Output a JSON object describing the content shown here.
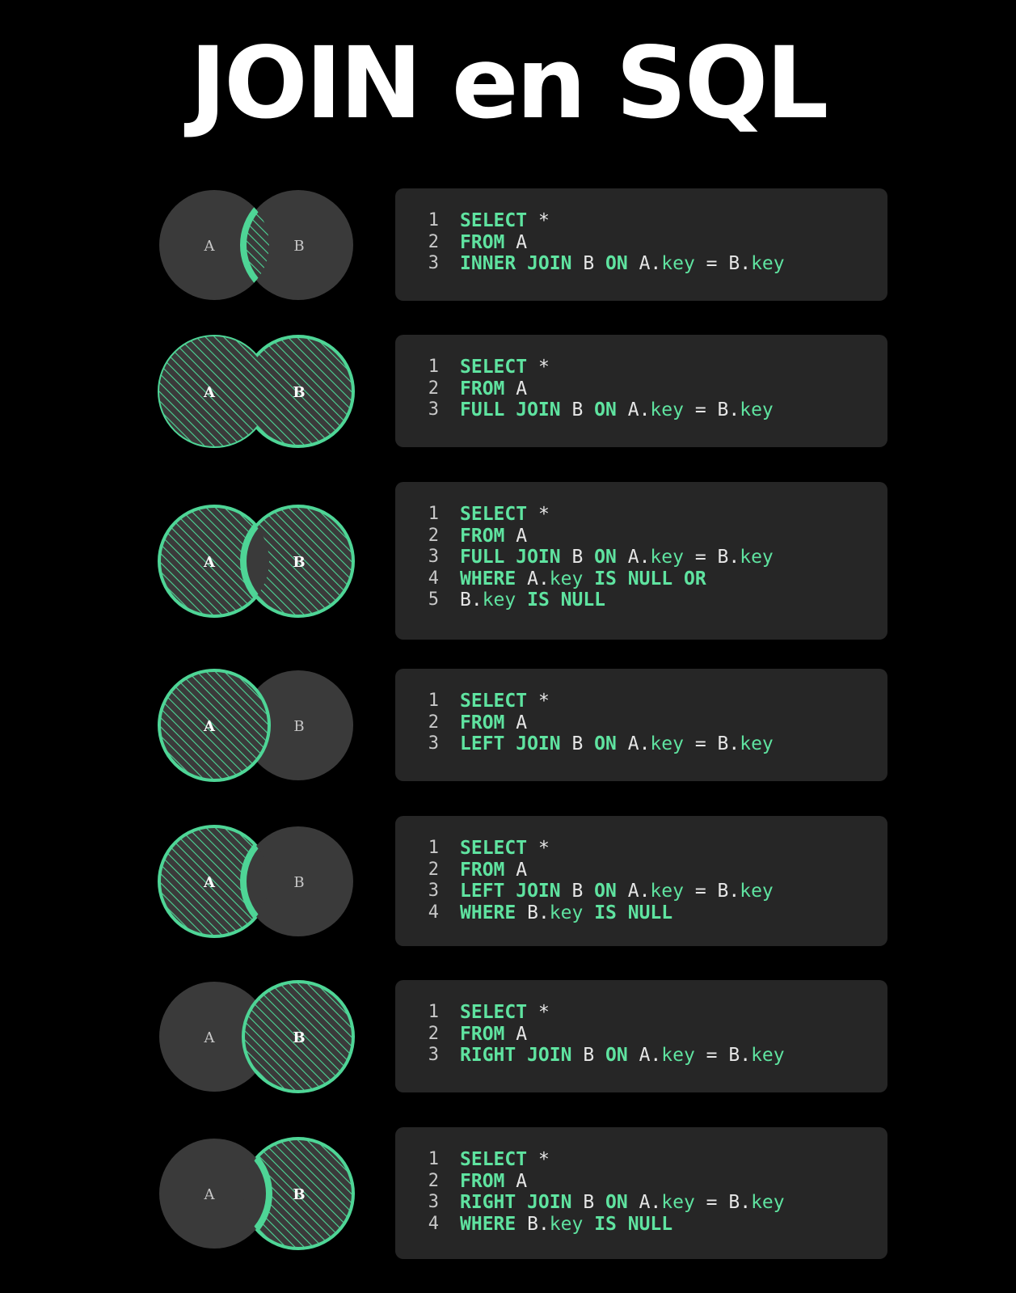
{
  "title": "JOIN en SQL",
  "colors": {
    "background": "#000000",
    "panel": "#262626",
    "circle_fill": "#3a3a3a",
    "accent_green": "#4ed596",
    "keyword": "#5fe3a0",
    "text": "#e6e6e6"
  },
  "joins": [
    {
      "name": "inner-join",
      "venn": {
        "left": "A",
        "right": "B",
        "highlight": "intersection"
      },
      "lines": [
        [
          [
            "kw",
            "SELECT"
          ],
          [
            "op",
            " *"
          ]
        ],
        [
          [
            "kw",
            "FROM"
          ],
          [
            "id",
            " A"
          ]
        ],
        [
          [
            "kw",
            "INNER JOIN"
          ],
          [
            "id",
            " B "
          ],
          [
            "kw",
            "ON"
          ],
          [
            "id",
            " A."
          ],
          [
            "key",
            "key"
          ],
          [
            "op",
            " = "
          ],
          [
            "id",
            "B."
          ],
          [
            "key",
            "key"
          ]
        ]
      ]
    },
    {
      "name": "full-join",
      "venn": {
        "left": "A",
        "right": "B",
        "highlight": "all"
      },
      "lines": [
        [
          [
            "kw",
            "SELECT"
          ],
          [
            "op",
            " *"
          ]
        ],
        [
          [
            "kw",
            "FROM"
          ],
          [
            "id",
            " A"
          ]
        ],
        [
          [
            "kw",
            "FULL JOIN"
          ],
          [
            "id",
            " B "
          ],
          [
            "kw",
            "ON"
          ],
          [
            "id",
            " A."
          ],
          [
            "key",
            "key"
          ],
          [
            "op",
            " = "
          ],
          [
            "id",
            "B."
          ],
          [
            "key",
            "key"
          ]
        ]
      ]
    },
    {
      "name": "full-join-exclusive",
      "venn": {
        "left": "A",
        "right": "B",
        "highlight": "exclusive-both"
      },
      "lines": [
        [
          [
            "kw",
            "SELECT"
          ],
          [
            "op",
            " *"
          ]
        ],
        [
          [
            "kw",
            "FROM"
          ],
          [
            "id",
            " A"
          ]
        ],
        [
          [
            "kw",
            "FULL JOIN"
          ],
          [
            "id",
            " B "
          ],
          [
            "kw",
            "ON"
          ],
          [
            "id",
            " A."
          ],
          [
            "key",
            "key"
          ],
          [
            "op",
            " = "
          ],
          [
            "id",
            "B."
          ],
          [
            "key",
            "key"
          ]
        ],
        [
          [
            "kw",
            "WHERE"
          ],
          [
            "id",
            " A."
          ],
          [
            "key",
            "key"
          ],
          [
            "kw",
            " IS NULL OR"
          ]
        ],
        [
          [
            "id",
            "B."
          ],
          [
            "key",
            "key"
          ],
          [
            "kw",
            " IS NULL"
          ]
        ]
      ]
    },
    {
      "name": "left-join",
      "venn": {
        "left": "A",
        "right": "B",
        "highlight": "left-full"
      },
      "lines": [
        [
          [
            "kw",
            "SELECT"
          ],
          [
            "op",
            " *"
          ]
        ],
        [
          [
            "kw",
            "FROM"
          ],
          [
            "id",
            " A"
          ]
        ],
        [
          [
            "kw",
            "LEFT JOIN"
          ],
          [
            "id",
            " B "
          ],
          [
            "kw",
            "ON"
          ],
          [
            "id",
            " A."
          ],
          [
            "key",
            "key"
          ],
          [
            "op",
            " = "
          ],
          [
            "id",
            "B."
          ],
          [
            "key",
            "key"
          ]
        ]
      ]
    },
    {
      "name": "left-join-exclusive",
      "venn": {
        "left": "A",
        "right": "B",
        "highlight": "left-only"
      },
      "lines": [
        [
          [
            "kw",
            "SELECT"
          ],
          [
            "op",
            " *"
          ]
        ],
        [
          [
            "kw",
            "FROM"
          ],
          [
            "id",
            " A"
          ]
        ],
        [
          [
            "kw",
            "LEFT JOIN"
          ],
          [
            "id",
            " B "
          ],
          [
            "kw",
            "ON"
          ],
          [
            "id",
            " A."
          ],
          [
            "key",
            "key"
          ],
          [
            "op",
            " = "
          ],
          [
            "id",
            "B."
          ],
          [
            "key",
            "key"
          ]
        ],
        [
          [
            "kw",
            "WHERE"
          ],
          [
            "id",
            " B."
          ],
          [
            "key",
            "key"
          ],
          [
            "kw",
            " IS NULL"
          ]
        ]
      ]
    },
    {
      "name": "right-join",
      "venn": {
        "left": "A",
        "right": "B",
        "highlight": "right-full"
      },
      "lines": [
        [
          [
            "kw",
            "SELECT"
          ],
          [
            "op",
            " *"
          ]
        ],
        [
          [
            "kw",
            "FROM"
          ],
          [
            "id",
            " A"
          ]
        ],
        [
          [
            "kw",
            "RIGHT JOIN"
          ],
          [
            "id",
            " B "
          ],
          [
            "kw",
            "ON"
          ],
          [
            "id",
            " A."
          ],
          [
            "key",
            "key"
          ],
          [
            "op",
            " = "
          ],
          [
            "id",
            "B."
          ],
          [
            "key",
            "key"
          ]
        ]
      ]
    },
    {
      "name": "right-join-exclusive",
      "venn": {
        "left": "A",
        "right": "B",
        "highlight": "right-only"
      },
      "lines": [
        [
          [
            "kw",
            "SELECT"
          ],
          [
            "op",
            " *"
          ]
        ],
        [
          [
            "kw",
            "FROM"
          ],
          [
            "id",
            " A"
          ]
        ],
        [
          [
            "kw",
            "RIGHT JOIN"
          ],
          [
            "id",
            " B "
          ],
          [
            "kw",
            "ON"
          ],
          [
            "id",
            " A."
          ],
          [
            "key",
            "key"
          ],
          [
            "op",
            " = "
          ],
          [
            "id",
            "B."
          ],
          [
            "key",
            "key"
          ]
        ],
        [
          [
            "kw",
            "WHERE"
          ],
          [
            "id",
            " B."
          ],
          [
            "key",
            "key"
          ],
          [
            "kw",
            " IS NULL"
          ]
        ]
      ]
    }
  ]
}
